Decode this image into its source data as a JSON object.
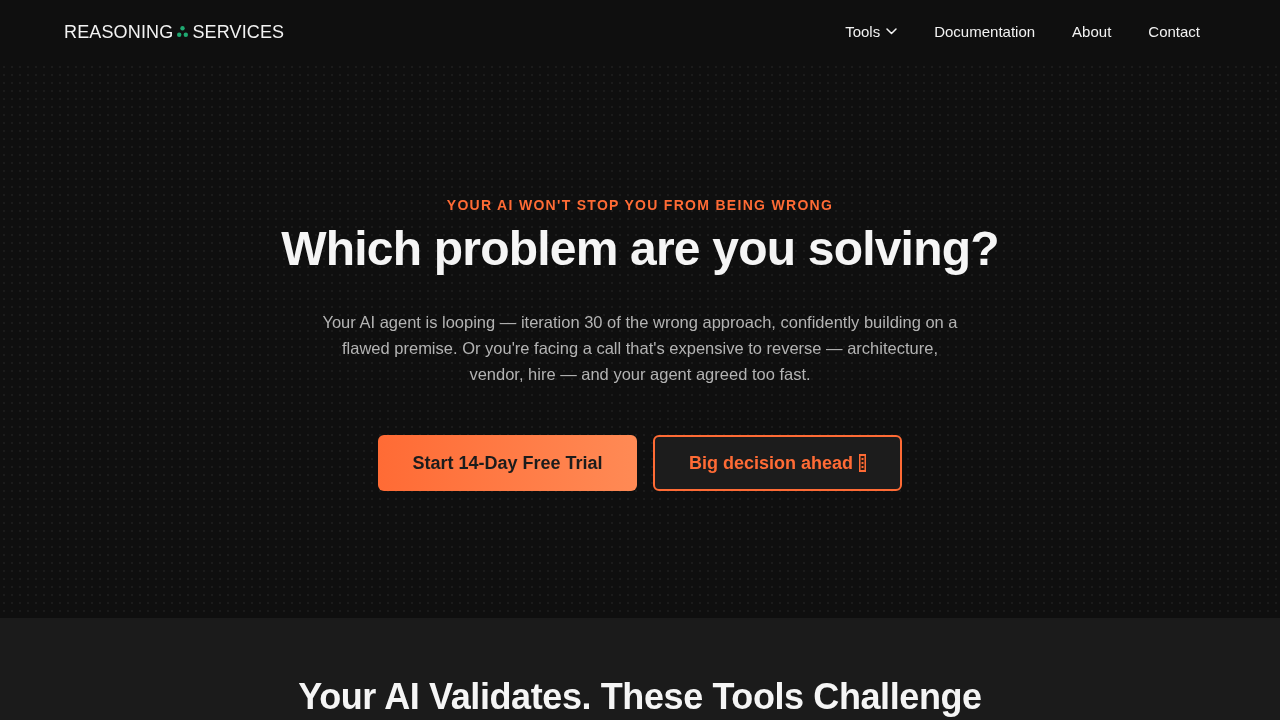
{
  "nav": {
    "logo": {
      "first_word": "REASONING",
      "second_word": "SERVICES"
    },
    "links": [
      {
        "label": "Tools",
        "kind": "dropdown"
      },
      {
        "label": "Documentation",
        "kind": "link"
      },
      {
        "label": "About",
        "kind": "link"
      },
      {
        "label": "Contact",
        "kind": "link"
      }
    ]
  },
  "hero": {
    "eyebrow": "YOUR AI WON'T STOP YOU FROM BEING WRONG",
    "title": "Which problem are you solving?",
    "description": "Your AI agent is looping — iteration 30 of the wrong approach, confidently building on a flawed premise. Or you're facing a call that's expensive to reverse — architecture, vendor, hire — and your agent agreed too fast.",
    "buttons": [
      {
        "label": "Start 14-Day Free Trial",
        "kind": "primary"
      },
      {
        "label": "Big decision ahead",
        "kind": "outline"
      }
    ]
  },
  "tools_section": {
    "title": "Your AI Validates. These Tools Challenge"
  }
}
